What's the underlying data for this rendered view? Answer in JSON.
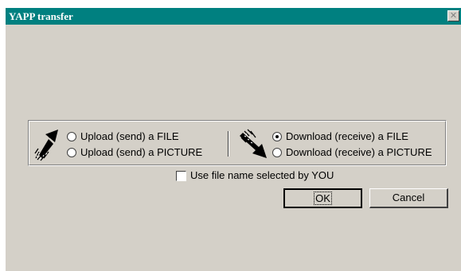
{
  "window": {
    "title": "YAPP transfer",
    "close_glyph": "✕"
  },
  "transfer": {
    "upload": {
      "file_label": "Upload (send) a FILE",
      "picture_label": "Upload (send) a PICTURE",
      "icon": "upload-arrow-icon"
    },
    "download": {
      "file_label": "Download (receive) a FILE",
      "picture_label": "Download (receive) a PICTURE",
      "icon": "download-arrow-icon"
    },
    "selected": "Download (receive) a FILE"
  },
  "options": {
    "use_file_name_label": "Use file name selected by YOU",
    "use_file_name_checked": false
  },
  "buttons": {
    "ok_label": "OK",
    "cancel_label": "Cancel"
  },
  "colors": {
    "titlebar": "#008080",
    "dialog_face": "#d4d0c8"
  }
}
